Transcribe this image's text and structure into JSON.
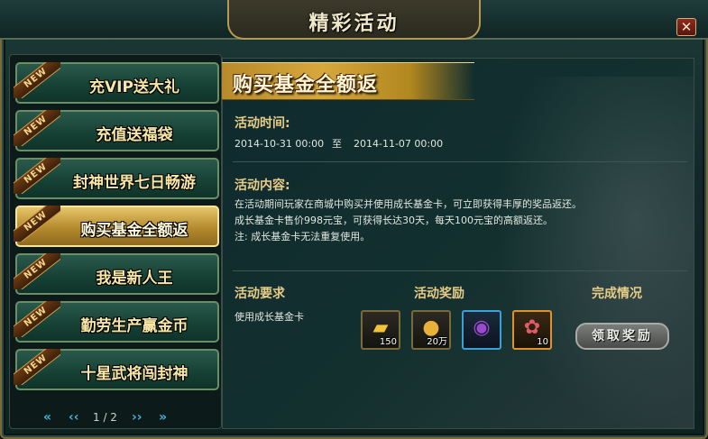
{
  "window": {
    "title": "精彩活动",
    "close_label": "✕"
  },
  "sidebar": {
    "items": [
      {
        "label": "充VIP送大礼",
        "badge": "NEW",
        "active": false
      },
      {
        "label": "充值送福袋",
        "badge": "NEW",
        "active": false
      },
      {
        "label": "封神世界七日畅游",
        "badge": "NEW",
        "active": false
      },
      {
        "label": "购买基金全额返",
        "badge": "NEW",
        "active": true
      },
      {
        "label": "我是新人王",
        "badge": "NEW",
        "active": false
      },
      {
        "label": "勤劳生产赢金币",
        "badge": "NEW",
        "active": false
      },
      {
        "label": "十星武将闯封神",
        "badge": "NEW",
        "active": false
      }
    ],
    "pager": {
      "page": "1 / 2",
      "first": "«",
      "prev": "‹‹",
      "next": "››",
      "last": "»"
    }
  },
  "activity": {
    "banner_title": "购买基金全额返",
    "time_label": "活动时间:",
    "time_start": "2014-10-31 00:00",
    "time_sep": "至",
    "time_end": "2014-11-07 00:00",
    "content_label": "活动内容:",
    "content_lines": [
      "在活动期间玩家在商城中购买并使用成长基金卡，可立即获得丰厚的奖品返还。",
      "成长基金卡售价998元宝，可获得长达30天，每天100元宝的高额返还。",
      "注: 成长基金卡无法重复使用。"
    ],
    "req_header": "活动要求",
    "reward_header": "活动奖励",
    "status_header": "完成情况",
    "requirement": "使用成长基金卡",
    "rewards": [
      {
        "icon": "gold-ingot-icon",
        "qty": "150"
      },
      {
        "icon": "coin-stack-icon",
        "qty": "20万"
      },
      {
        "icon": "purple-orb-icon",
        "qty": ""
      },
      {
        "icon": "flower-icon",
        "qty": "10"
      }
    ],
    "claim_label": "领取奖励"
  },
  "colors": {
    "accent_gold": "#e8cc86",
    "active_tab": "#d6a83c",
    "frame": "#7a6a3a"
  }
}
